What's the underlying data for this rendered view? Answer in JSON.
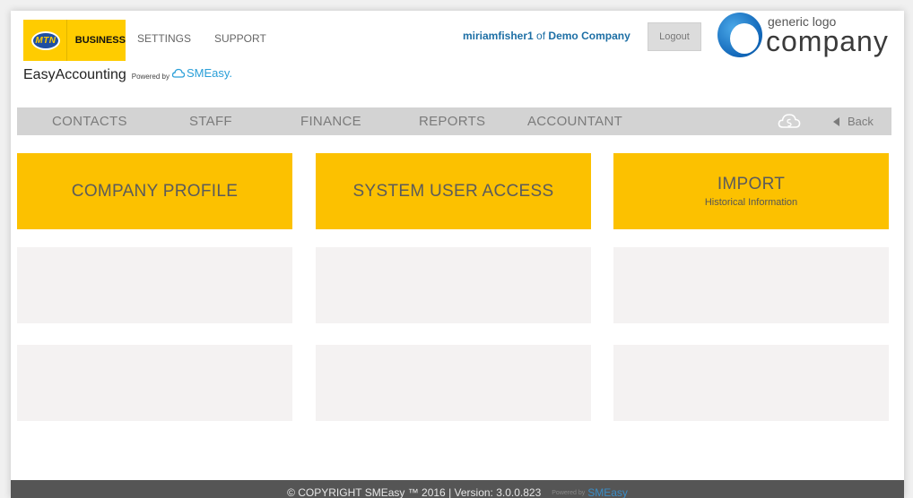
{
  "header": {
    "brand_mtn": "MTN",
    "brand_business": "BUSINESS",
    "links": [
      "SETTINGS",
      "SUPPORT"
    ],
    "app_name": "EasyAccounting",
    "powered_by": "Powered by",
    "smeasy": "SMEasy.",
    "username": "miriamfisher1",
    "of_text": "of",
    "company": "Demo Company",
    "logout_label": "Logout",
    "logo_generic": "generic logo",
    "logo_company": "company"
  },
  "nav": {
    "items": [
      "CONTACTS",
      "STAFF",
      "FINANCE",
      "REPORTS",
      "ACCOUNTANT"
    ],
    "back_label": "Back"
  },
  "tiles": [
    {
      "title": "COMPANY PROFILE",
      "subtitle": ""
    },
    {
      "title": "SYSTEM USER ACCESS",
      "subtitle": ""
    },
    {
      "title": "IMPORT",
      "subtitle": "Historical Information"
    }
  ],
  "footer": {
    "copyright": "© COPYRIGHT SMEasy ™ 2016 | Version: 3.0.0.823",
    "powered_by": "Powered by",
    "smeasy": "SMEasy"
  },
  "colors": {
    "tile_accent": "#fcc100",
    "mtn_yellow": "#ffcc00",
    "link_blue": "#1d6fa5",
    "nav_bg": "#d3d3d3",
    "footer_bg": "#555555"
  }
}
